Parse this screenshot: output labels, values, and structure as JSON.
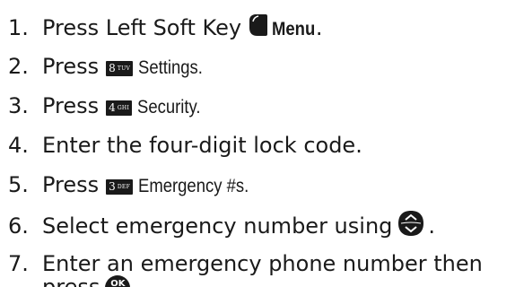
{
  "steps": [
    {
      "num": "1.",
      "parts": [
        "Press Left Soft Key",
        "Menu",
        "."
      ]
    },
    {
      "num": "2.",
      "text": "Press",
      "key": {
        "main": "8",
        "sub": "TUV"
      },
      "label": "Settings."
    },
    {
      "num": "3.",
      "text": "Press",
      "key": {
        "main": "4",
        "sub": "GHI"
      },
      "label": "Security."
    },
    {
      "num": "4.",
      "text": "Enter the four-digit lock code."
    },
    {
      "num": "5.",
      "text": "Press",
      "key": {
        "main": "3",
        "sub": "DEF"
      },
      "label": "Emergency #s."
    },
    {
      "num": "6.",
      "text": "Select emergency number using",
      "after": "."
    },
    {
      "num": "7.",
      "line1": "Enter an emergency phone number then",
      "line2": "press",
      "after": ".",
      "ok_icon": {
        "main": "OK",
        "sub": "⌂"
      }
    }
  ],
  "icons": {
    "left_soft_key": "left-soft-key-icon",
    "navigation_key": "navigation-key-icon",
    "ok_key": "ok-key-icon"
  },
  "colors": {
    "text": "#1a1a1a",
    "key_bg": "#1a1a1a",
    "key_text": "#ffffff"
  }
}
